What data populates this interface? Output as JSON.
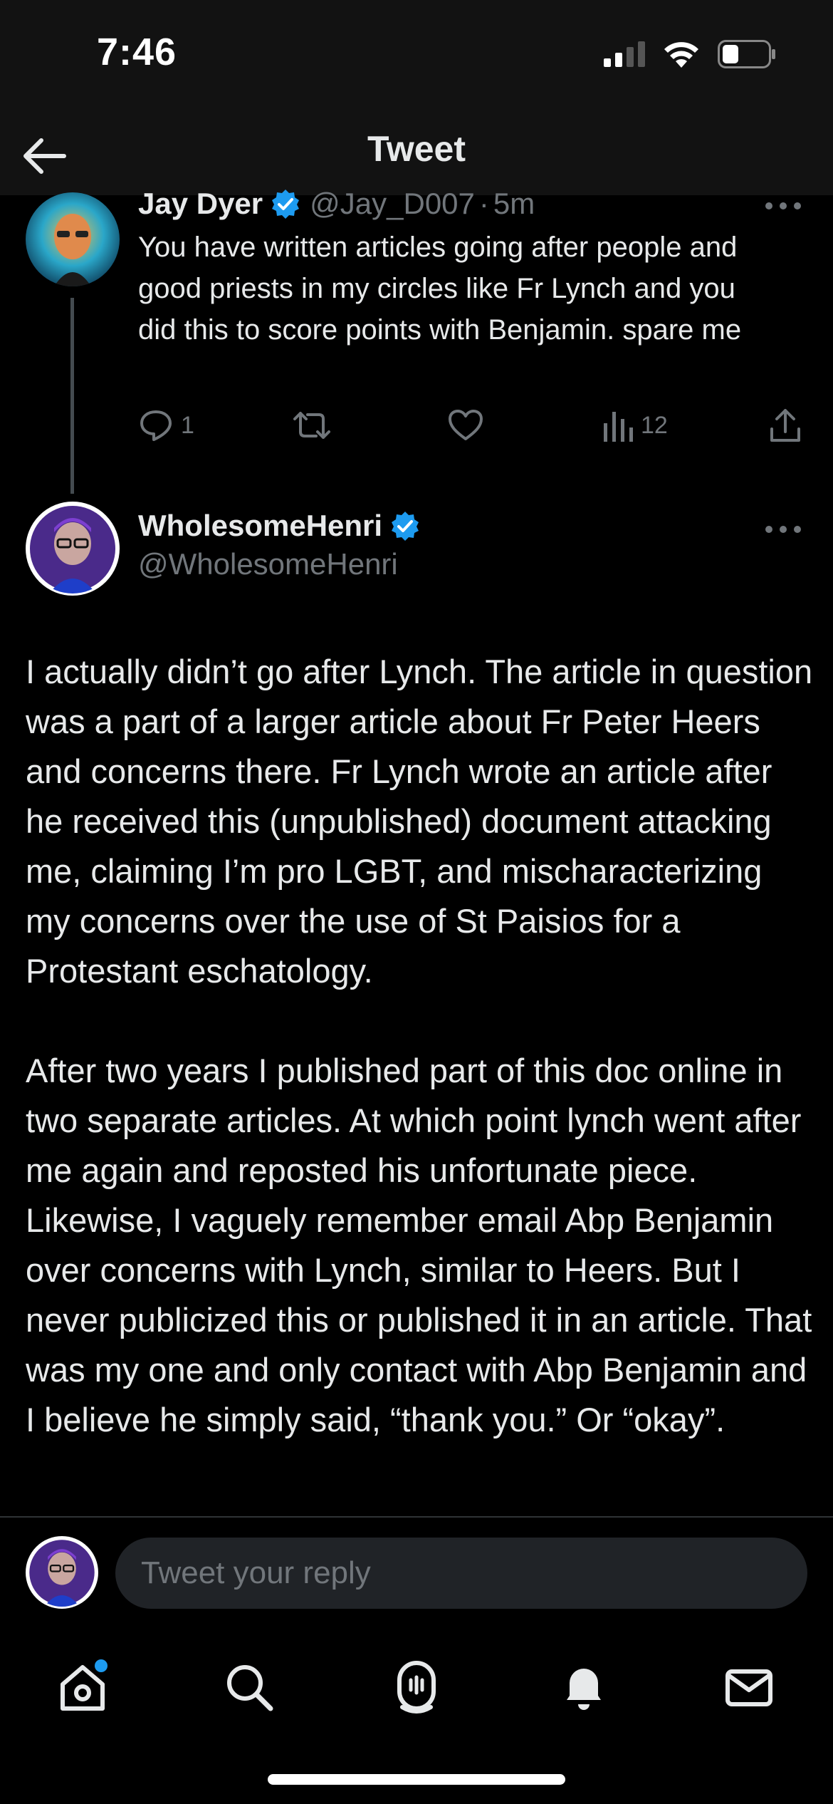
{
  "status": {
    "time": "7:46"
  },
  "header": {
    "title": "Tweet"
  },
  "reply_tweet": {
    "display_name": "Jay Dyer",
    "handle": "@Jay_D007",
    "separator": "·",
    "time_ago": "5m",
    "text": "You have written articles going after people and good priests in my circles like Fr Lynch and you did this to score points with Benjamin. spare me",
    "reply_count": "1",
    "view_count": "12"
  },
  "main_tweet": {
    "display_name": "WholesomeHenri",
    "handle": "@WholesomeHenri",
    "paragraphs": [
      "I actually didn’t go after Lynch. The article in question was a part of a larger article about Fr Peter Heers and concerns there. Fr Lynch wrote an article after he received this (unpublished) document attacking me, claiming I’m pro LGBT, and mischaracterizing my concerns over the use of St Paisios for a Protestant eschatology.",
      "After two years I published part of this doc online in two separate articles. At which point lynch went after me again and reposted his unfortunate piece. Likewise, I vaguely remember email Abp Benjamin over concerns with Lynch, similar to Heers. But I never publicized this or published it in an article. That was my one and only contact with Abp Benjamin and I believe he simply said, “thank you.” Or “okay”."
    ]
  },
  "reply_bar": {
    "placeholder": "Tweet your reply"
  },
  "colors": {
    "accent": "#1d9bf0",
    "muted": "#71767b",
    "background": "#000000"
  },
  "icons": {
    "back": "arrow-left-icon",
    "verified": "verified-badge-icon",
    "reply": "reply-icon",
    "retweet": "retweet-icon",
    "like": "heart-icon",
    "views": "views-icon",
    "share": "share-icon",
    "home": "home-icon",
    "search": "search-icon",
    "spaces": "spaces-icon",
    "notifications": "bell-icon",
    "messages": "mail-icon"
  }
}
